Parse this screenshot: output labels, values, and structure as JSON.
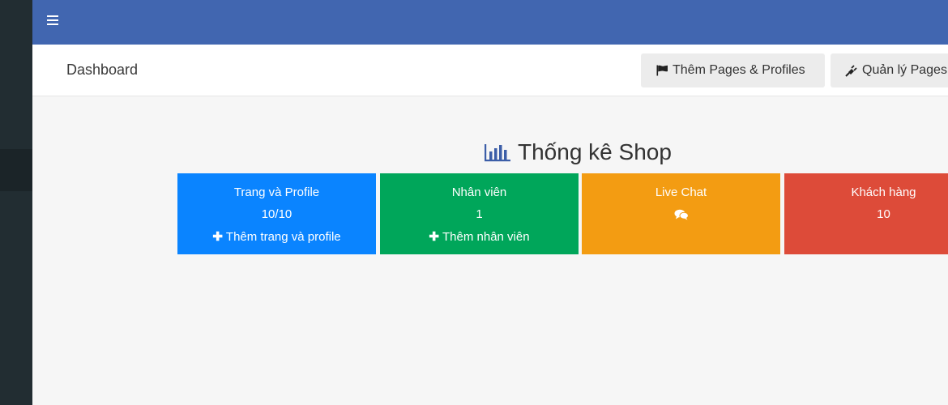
{
  "colors": {
    "topbar": "#4166b0",
    "sidebar": "#222d32",
    "card_blue": "#0a84ff",
    "card_green": "#00a65a",
    "card_orange": "#f39c12",
    "card_red": "#dd4b39"
  },
  "header": {
    "menu_icon": "hamburger-icon"
  },
  "subheader": {
    "title": "Dashboard",
    "buttons": [
      {
        "label": "Thêm Pages & Profiles",
        "icon": "flag-icon"
      },
      {
        "label": "Quản lý Pages",
        "icon": "plug-icon"
      }
    ]
  },
  "stats": {
    "title": "Thống kê Shop",
    "title_icon": "bar-chart-icon",
    "cards": [
      {
        "title": "Trang và Profile",
        "value": "10/10",
        "link": "Thêm trang và profile",
        "color": "#0a84ff"
      },
      {
        "title": "Nhân viên",
        "value": "1",
        "link": "Thêm nhân viên",
        "color": "#00a65a"
      },
      {
        "title": "Live Chat",
        "icon": "comments-icon",
        "color": "#f39c12"
      },
      {
        "title": "Khách hàng",
        "value": "10",
        "color": "#dd4b39"
      }
    ]
  }
}
